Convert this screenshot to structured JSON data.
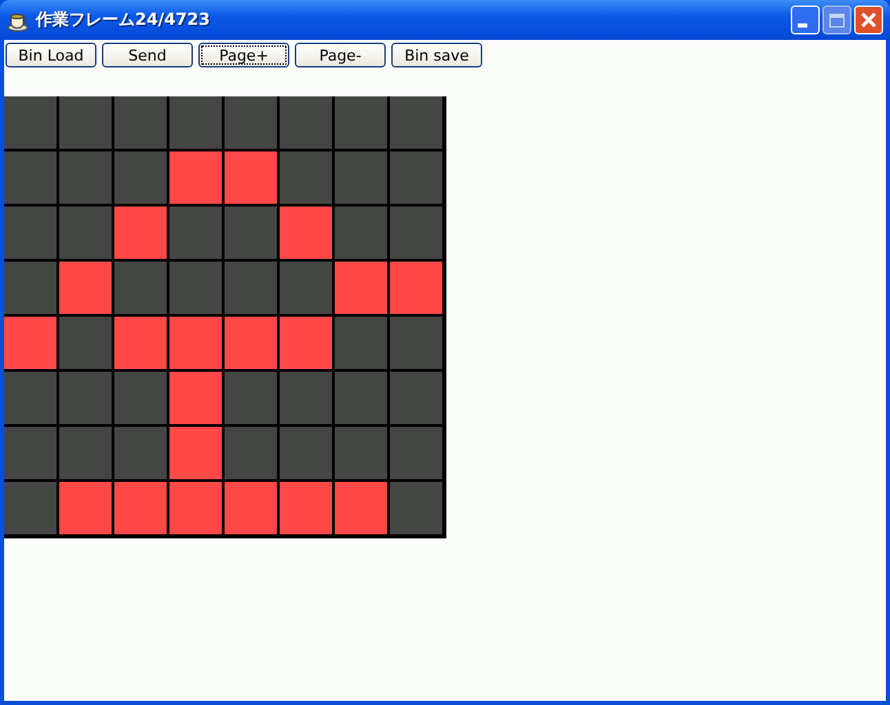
{
  "window": {
    "title": "作業フレーム24/4723"
  },
  "buttons": [
    {
      "label": "Bin Load",
      "focused": false
    },
    {
      "label": "Send",
      "focused": false
    },
    {
      "label": "Page+",
      "focused": true
    },
    {
      "label": "Page-",
      "focused": false
    },
    {
      "label": "Bin save",
      "focused": false
    }
  ],
  "grid": {
    "rows": [
      [
        {
          "on": false
        },
        {
          "on": false
        },
        {
          "on": false
        },
        {
          "on": false
        },
        {
          "on": false
        },
        {
          "on": false
        },
        {
          "on": false
        },
        {
          "on": false
        }
      ],
      [
        {
          "on": false
        },
        {
          "on": false
        },
        {
          "on": false
        },
        {
          "on": true
        },
        {
          "on": true
        },
        {
          "on": false
        },
        {
          "on": false
        },
        {
          "on": false
        }
      ],
      [
        {
          "on": false
        },
        {
          "on": false
        },
        {
          "on": true
        },
        {
          "on": false
        },
        {
          "on": false
        },
        {
          "on": true
        },
        {
          "on": false
        },
        {
          "on": false
        }
      ],
      [
        {
          "on": false
        },
        {
          "on": true
        },
        {
          "on": false
        },
        {
          "on": false
        },
        {
          "on": false
        },
        {
          "on": false
        },
        {
          "on": true
        },
        {
          "on": true
        }
      ],
      [
        {
          "on": true
        },
        {
          "on": false
        },
        {
          "on": true
        },
        {
          "on": true
        },
        {
          "on": true
        },
        {
          "on": true
        },
        {
          "on": false
        },
        {
          "on": false
        }
      ],
      [
        {
          "on": false
        },
        {
          "on": false
        },
        {
          "on": false
        },
        {
          "on": true
        },
        {
          "on": false
        },
        {
          "on": false
        },
        {
          "on": false
        },
        {
          "on": false
        }
      ],
      [
        {
          "on": false
        },
        {
          "on": false
        },
        {
          "on": false
        },
        {
          "on": true
        },
        {
          "on": false
        },
        {
          "on": false
        },
        {
          "on": false
        },
        {
          "on": false
        }
      ],
      [
        {
          "on": false
        },
        {
          "on": true
        },
        {
          "on": true
        },
        {
          "on": true
        },
        {
          "on": true
        },
        {
          "on": true
        },
        {
          "on": true
        },
        {
          "on": false
        }
      ]
    ]
  }
}
